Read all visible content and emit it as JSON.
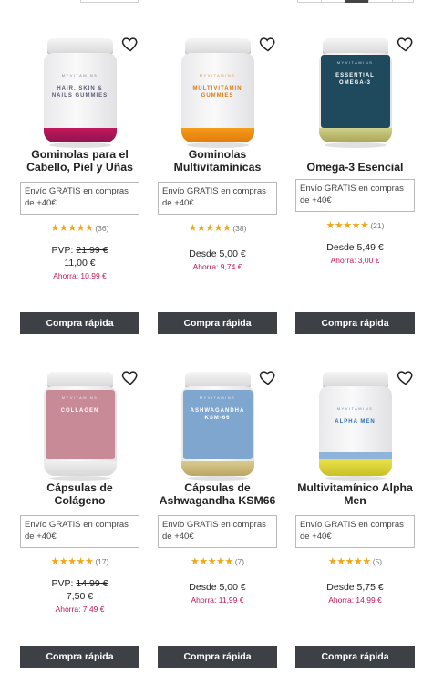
{
  "shipping_text": "Envío GRATIS en compras de +40€",
  "quick_buy_label": "Compra rápida",
  "star_color": "#f0a71a",
  "savings_color": "#c2185b",
  "button_color": "#3d4146",
  "products": [
    {
      "title": "Gominolas para el Cabello, Piel y Uñas",
      "jar_label": "HAIR, SKIN & NAILS GUMMIES",
      "jar_brand": "MYVITAMINS",
      "stars": "★★★★★",
      "rating_count": "(36)",
      "rrp_prefix": "PVP:",
      "rrp_value": "21,99 €",
      "price": "11,00 €",
      "savings": "Ahorra: 10,99 €"
    },
    {
      "title": "Gominolas Multivitamínicas",
      "jar_label": "MULTIVITAMIN GUMMIES",
      "jar_brand": "MYVITAMINS",
      "stars": "★★★★★",
      "rating_count": "(38)",
      "price": "Desde 5,00 €",
      "savings": "Ahorra: 9,74 €"
    },
    {
      "title": "Omega-3 Esencial",
      "jar_label": "ESSENTIAL OMEGA-3",
      "jar_brand": "MYVITAMINS",
      "stars": "★★★★★",
      "rating_count": "(21)",
      "price": "Desde 5,49 €",
      "savings": "Ahorra: 3,00 €"
    },
    {
      "title": "Cápsulas de Colágeno",
      "jar_label": "COLLAGEN",
      "jar_brand": "MYVITAMINS",
      "stars": "★★★★★",
      "rating_count": "(17)",
      "rrp_prefix": "PVP:",
      "rrp_value": "14,99 €",
      "price": "7,50 €",
      "savings": "Ahorra: 7,49 €"
    },
    {
      "title": "Cápsulas de Ashwagandha KSM66",
      "jar_label": "ASHWAGANDHA KSM-66",
      "jar_brand": "MYVITAMINS",
      "stars": "★★★★★",
      "rating_count": "(7)",
      "price": "Desde 5,00 €",
      "savings": "Ahorra: 11,99 €"
    },
    {
      "title": "Multivitamínico Alpha Men",
      "jar_label": "ALPHA MEN",
      "jar_brand": "MYVITAMINS",
      "stars": "★★★★★",
      "rating_count": "(5)",
      "price": "Desde 5,75 €",
      "savings": "Ahorra: 14,99 €"
    }
  ]
}
